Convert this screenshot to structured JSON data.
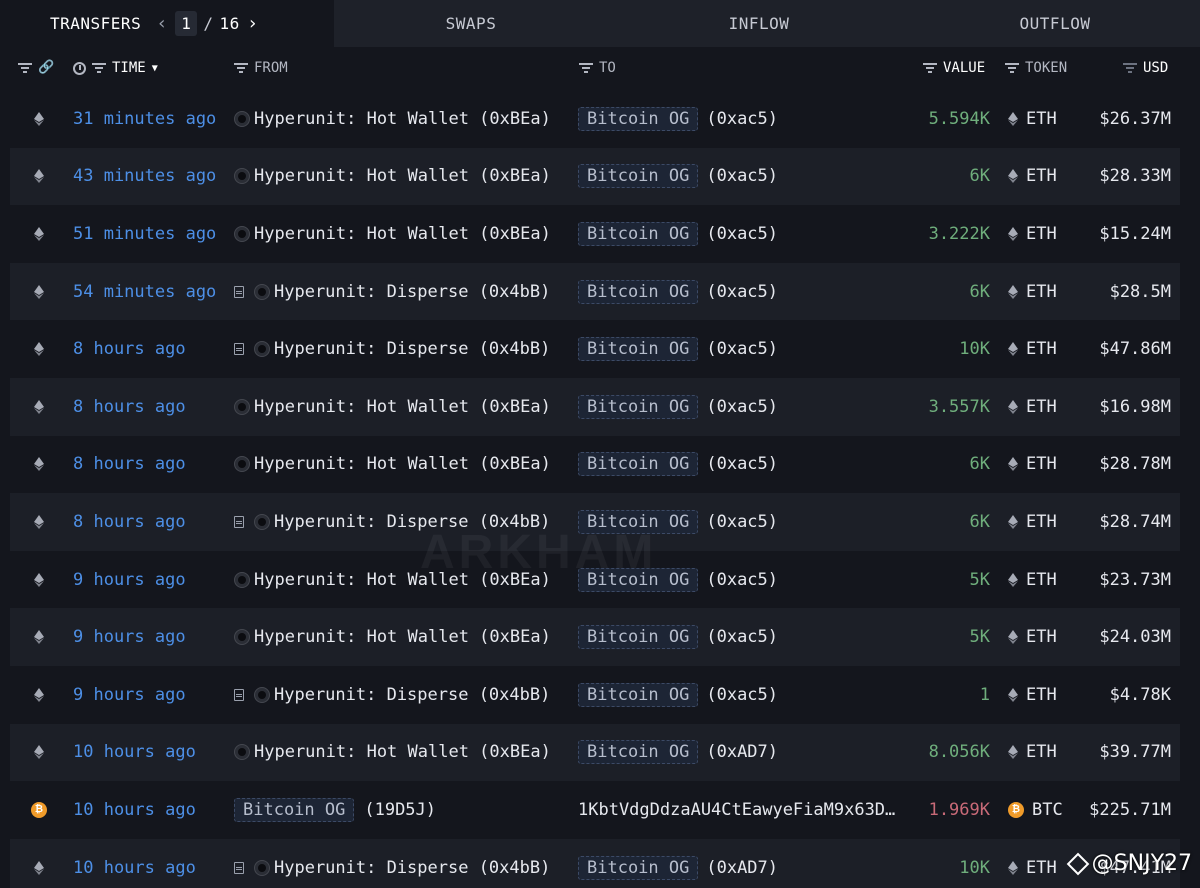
{
  "tabs": {
    "transfers": "TRANSFERS",
    "swaps": "SWAPS",
    "inflow": "INFLOW",
    "outflow": "OUTFLOW",
    "page_current": "1",
    "page_sep": "/",
    "page_total": "16"
  },
  "header": {
    "time": "TIME",
    "from": "FROM",
    "to": "TO",
    "value": "VALUE",
    "token": "TOKEN",
    "usd": "USD"
  },
  "rows": [
    {
      "chain": "eth",
      "time": "31 minutes ago",
      "from_doc": false,
      "from": "Hyperunit: Hot Wallet (0xBEa)",
      "to_badge": "Bitcoin OG",
      "to_addr": "(0xac5)",
      "value": "5.594K",
      "token": "ETH",
      "usd": "$26.37M"
    },
    {
      "chain": "eth",
      "time": "43 minutes ago",
      "from_doc": false,
      "from": "Hyperunit: Hot Wallet (0xBEa)",
      "to_badge": "Bitcoin OG",
      "to_addr": "(0xac5)",
      "value": "6K",
      "token": "ETH",
      "usd": "$28.33M"
    },
    {
      "chain": "eth",
      "time": "51 minutes ago",
      "from_doc": false,
      "from": "Hyperunit: Hot Wallet (0xBEa)",
      "to_badge": "Bitcoin OG",
      "to_addr": "(0xac5)",
      "value": "3.222K",
      "token": "ETH",
      "usd": "$15.24M"
    },
    {
      "chain": "eth",
      "time": "54 minutes ago",
      "from_doc": true,
      "from": "Hyperunit: Disperse (0x4bB)",
      "to_badge": "Bitcoin OG",
      "to_addr": "(0xac5)",
      "value": "6K",
      "token": "ETH",
      "usd": "$28.5M"
    },
    {
      "chain": "eth",
      "time": "8 hours ago",
      "from_doc": true,
      "from": "Hyperunit: Disperse (0x4bB)",
      "to_badge": "Bitcoin OG",
      "to_addr": "(0xac5)",
      "value": "10K",
      "token": "ETH",
      "usd": "$47.86M"
    },
    {
      "chain": "eth",
      "time": "8 hours ago",
      "from_doc": false,
      "from": "Hyperunit: Hot Wallet (0xBEa)",
      "to_badge": "Bitcoin OG",
      "to_addr": "(0xac5)",
      "value": "3.557K",
      "token": "ETH",
      "usd": "$16.98M"
    },
    {
      "chain": "eth",
      "time": "8 hours ago",
      "from_doc": false,
      "from": "Hyperunit: Hot Wallet (0xBEa)",
      "to_badge": "Bitcoin OG",
      "to_addr": "(0xac5)",
      "value": "6K",
      "token": "ETH",
      "usd": "$28.78M"
    },
    {
      "chain": "eth",
      "time": "8 hours ago",
      "from_doc": true,
      "from": "Hyperunit: Disperse (0x4bB)",
      "to_badge": "Bitcoin OG",
      "to_addr": "(0xac5)",
      "value": "6K",
      "token": "ETH",
      "usd": "$28.74M"
    },
    {
      "chain": "eth",
      "time": "9 hours ago",
      "from_doc": false,
      "from": "Hyperunit: Hot Wallet (0xBEa)",
      "to_badge": "Bitcoin OG",
      "to_addr": "(0xac5)",
      "value": "5K",
      "token": "ETH",
      "usd": "$23.73M"
    },
    {
      "chain": "eth",
      "time": "9 hours ago",
      "from_doc": false,
      "from": "Hyperunit: Hot Wallet (0xBEa)",
      "to_badge": "Bitcoin OG",
      "to_addr": "(0xac5)",
      "value": "5K",
      "token": "ETH",
      "usd": "$24.03M"
    },
    {
      "chain": "eth",
      "time": "9 hours ago",
      "from_doc": true,
      "from": "Hyperunit: Disperse (0x4bB)",
      "to_badge": "Bitcoin OG",
      "to_addr": "(0xac5)",
      "value": "1",
      "token": "ETH",
      "usd": "$4.78K"
    },
    {
      "chain": "eth",
      "time": "10 hours ago",
      "from_doc": false,
      "from": "Hyperunit: Hot Wallet (0xBEa)",
      "to_badge": "Bitcoin OG",
      "to_addr": "(0xAD7)",
      "value": "8.056K",
      "token": "ETH",
      "usd": "$39.77M"
    },
    {
      "chain": "btc",
      "time": "10 hours ago",
      "from_badge": "Bitcoin OG",
      "from": "(19D5J)",
      "to_plain": "1KbtVdgDdzaAU4CtEawyeFiaM9x63D…",
      "value": "1.969K",
      "token": "BTC",
      "usd": "$225.71M",
      "outflow": true
    },
    {
      "chain": "eth",
      "time": "10 hours ago",
      "from_doc": true,
      "from": "Hyperunit: Disperse (0x4bB)",
      "to_badge": "Bitcoin OG",
      "to_addr": "(0xAD7)",
      "value": "10K",
      "token": "ETH",
      "usd": "$47.41M"
    }
  ],
  "watermark": "ARKHAM",
  "credit": "@SNJY27",
  "colors": {
    "time_link": "#4d8fe6",
    "value_in": "#6fae7c",
    "value_out": "#c96a78",
    "btc": "#f09b2a"
  }
}
